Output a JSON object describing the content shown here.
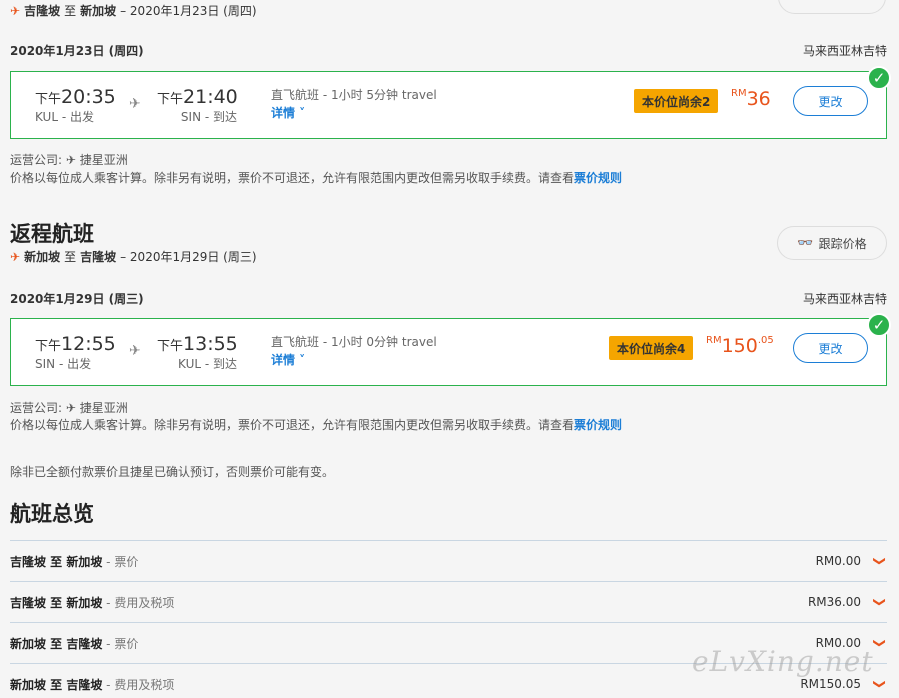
{
  "outbound": {
    "route": {
      "from": "吉隆坡",
      "to_word": "至",
      "to": "新加坡",
      "date": "– 2020年1月23日 (周四)"
    },
    "date_header": "2020年1月23日 (周四)",
    "airline_right": "马来西亚林吉特",
    "card": {
      "dep_ampm": "下午",
      "dep_time": "20:35",
      "dep_sub": "KUL - 出发",
      "arr_ampm": "下午",
      "arr_time": "21:40",
      "arr_sub": "SIN - 到达",
      "info": "直飞航班 - 1小时 5分钟 travel",
      "detail": "详情 ˅",
      "badge": "本价位尚余2",
      "currency": "RM",
      "price": "36",
      "price_dec": "",
      "change": "更改"
    },
    "operator": "运营公司: ✈ 捷星亚洲",
    "note": "价格以每位成人乘客计算。除非另有说明，票价不可退还，允许有限范围内更改但需另收取手续费。请查看",
    "note_link": "票价规则"
  },
  "return": {
    "title": "返程航班",
    "track": "跟踪价格",
    "route": {
      "from": "新加坡",
      "to_word": "至",
      "to": "吉隆坡",
      "date": "– 2020年1月29日 (周三)"
    },
    "date_header": "2020年1月29日 (周三)",
    "airline_right": "马来西亚林吉特",
    "card": {
      "dep_ampm": "下午",
      "dep_time": "12:55",
      "dep_sub": "SIN - 出发",
      "arr_ampm": "下午",
      "arr_time": "13:55",
      "arr_sub": "KUL - 到达",
      "info": "直飞航班 - 1小时 0分钟 travel",
      "detail": "详情 ˅",
      "badge": "本价位尚余4",
      "currency": "RM",
      "price": "150",
      "price_dec": ".05",
      "change": "更改"
    },
    "operator": "运营公司: ✈ 捷星亚洲",
    "note": "价格以每位成人乘客计算。除非另有说明，票价不可退还，允许有限范围内更改但需另收取手续费。请查看",
    "note_link": "票价规则"
  },
  "disclaimer": "除非已全额付款票价且捷星已确认预订，否则票价可能有变。",
  "summary": {
    "title": "航班总览",
    "rows": [
      {
        "route": "吉隆坡 至 新加坡",
        "sub": " - 票价",
        "amount": "RM0.00"
      },
      {
        "route": "吉隆坡 至 新加坡",
        "sub": " - 费用及税项",
        "amount": "RM36.00"
      },
      {
        "route": "新加坡 至 吉隆坡",
        "sub": " - 票价",
        "amount": "RM0.00"
      },
      {
        "route": "新加坡 至 吉隆坡",
        "sub": " - 费用及税项",
        "amount": "RM150.05"
      }
    ]
  },
  "watermark": "eLvXing.net",
  "colors": {
    "accent": "#e8541c",
    "link": "#1c7ed6",
    "success": "#2bb24c",
    "badge": "#f5a500"
  }
}
